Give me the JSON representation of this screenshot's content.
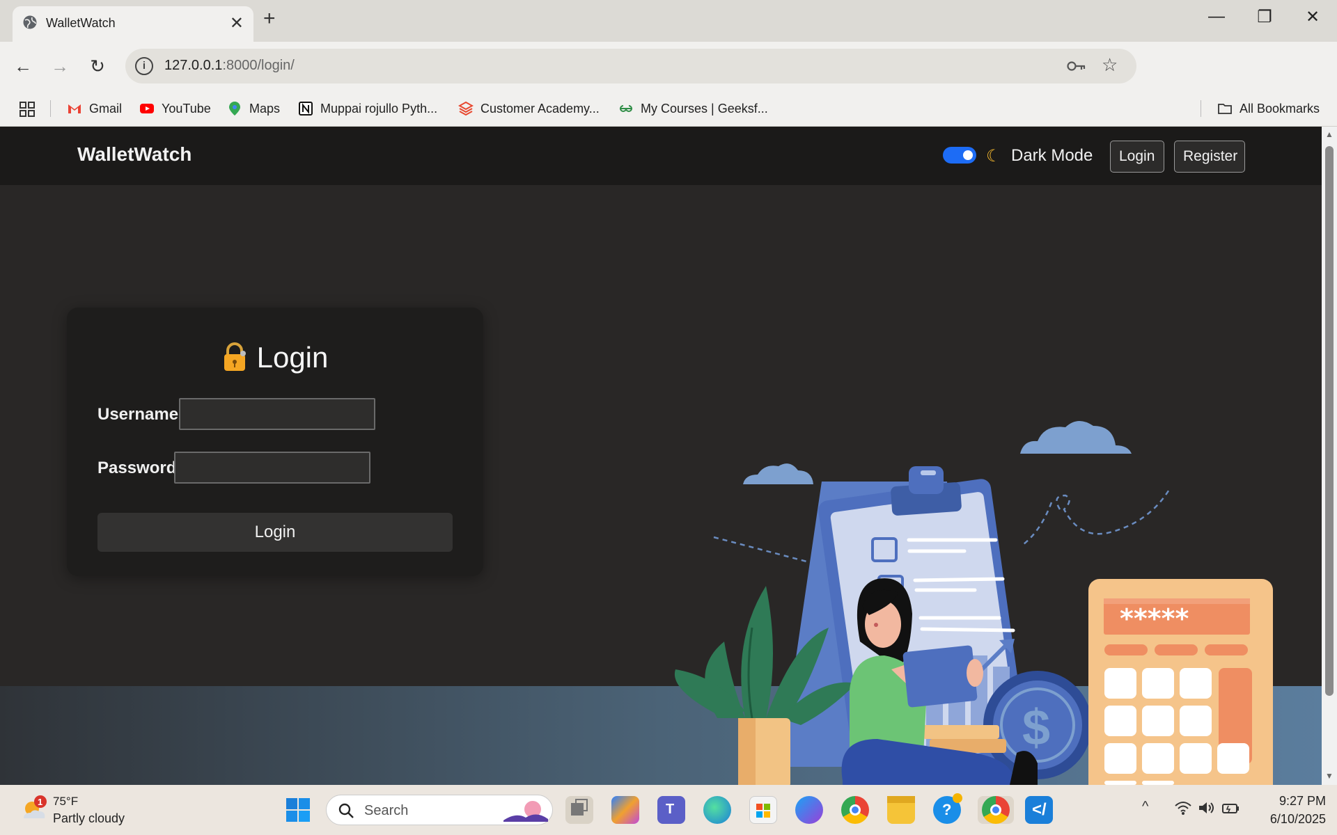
{
  "browser": {
    "tab_title": "WalletWatch",
    "url_host": "127.0.0.1",
    "url_path": ":8000/login/",
    "bookmarks": [
      {
        "label": "Gmail"
      },
      {
        "label": "YouTube"
      },
      {
        "label": "Maps"
      },
      {
        "label": "Muppai rojullo Pyth..."
      },
      {
        "label": "Customer Academy..."
      },
      {
        "label": "My Courses | Geeksf..."
      }
    ],
    "all_bookmarks": "All Bookmarks"
  },
  "navbar": {
    "brand": "WalletWatch",
    "dark_mode_label": "Dark Mode",
    "dark_mode_on": true,
    "login_label": "Login",
    "register_label": "Register"
  },
  "login_form": {
    "title": "Login",
    "username_label": "Username",
    "username_value": "",
    "password_label": "Password",
    "password_value": "",
    "submit_label": "Login"
  },
  "illustration": {
    "calculator_display": "*****"
  },
  "taskbar": {
    "weather_temp": "75°F",
    "weather_desc": "Partly cloudy",
    "weather_badge": "1",
    "search_placeholder": "Search",
    "time": "9:27 PM",
    "date": "6/10/2025"
  },
  "colors": {
    "accent": "#1d6cf5",
    "page_bg": "#292726",
    "navbar_bg": "#1b1a19",
    "card_bg": "#1e1d1c"
  }
}
